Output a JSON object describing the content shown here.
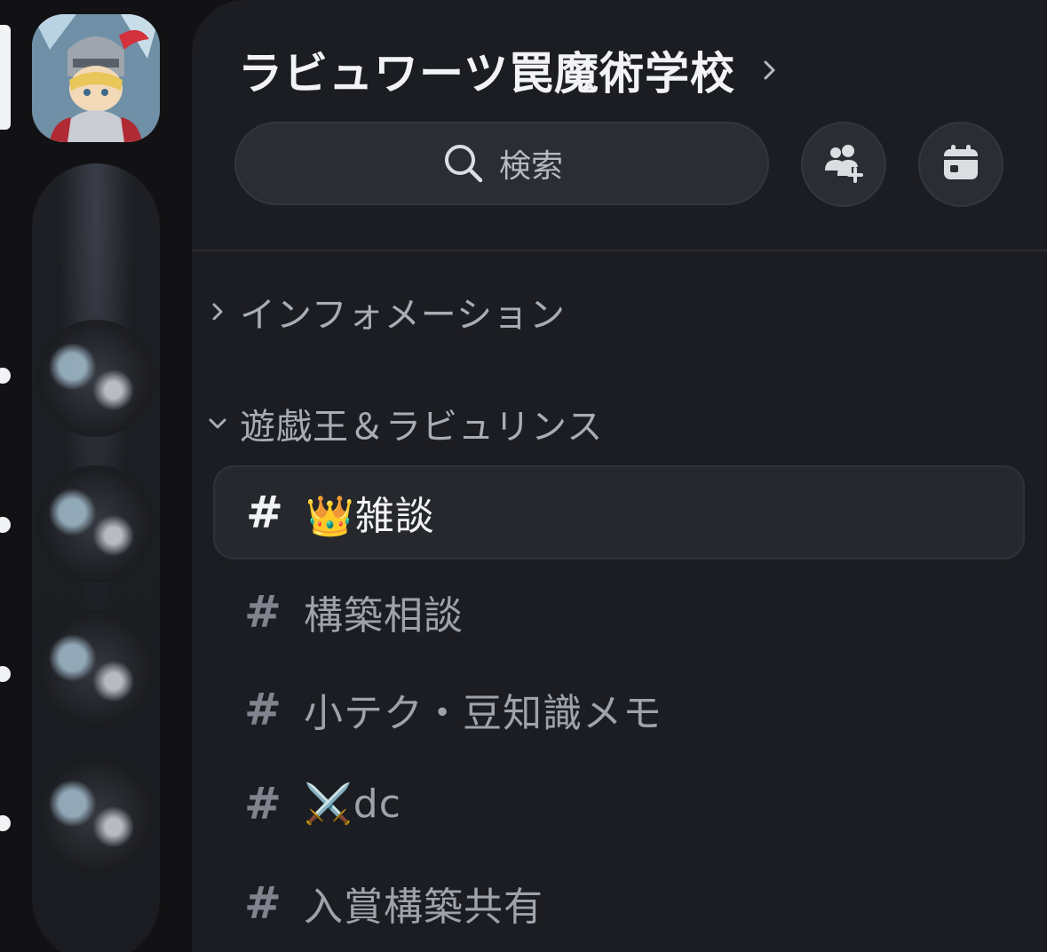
{
  "server": {
    "name": "ラビュワーツ罠魔術学校"
  },
  "search": {
    "label": "検索"
  },
  "categories": [
    {
      "label": "インフォメーション",
      "collapsed": true
    },
    {
      "label": "遊戯王＆ラビュリンス",
      "collapsed": false
    }
  ],
  "channels": [
    {
      "hash": "#",
      "name": "👑雑談",
      "active": true
    },
    {
      "hash": "#",
      "name": "構築相談",
      "active": false
    },
    {
      "hash": "#",
      "name": "小テク・豆知識メモ",
      "active": false
    },
    {
      "hash": "#",
      "name": "⚔️dc",
      "active": false
    },
    {
      "hash": "#",
      "name": "入賞構築共有",
      "active": false
    }
  ],
  "icons": {
    "search": "search-icon",
    "invite": "add-member-icon",
    "events": "calendar-icon",
    "header_chevron": "chevron-right-icon",
    "category_collapsed": "chevron-right-icon",
    "category_expanded": "chevron-down-icon"
  },
  "colors": {
    "panel_bg": "#1c1d22",
    "rail_bg": "#121214",
    "active_channel_bg": "#26282e",
    "text_primary": "#f2f3f5",
    "text_muted": "#9ea3ab"
  }
}
